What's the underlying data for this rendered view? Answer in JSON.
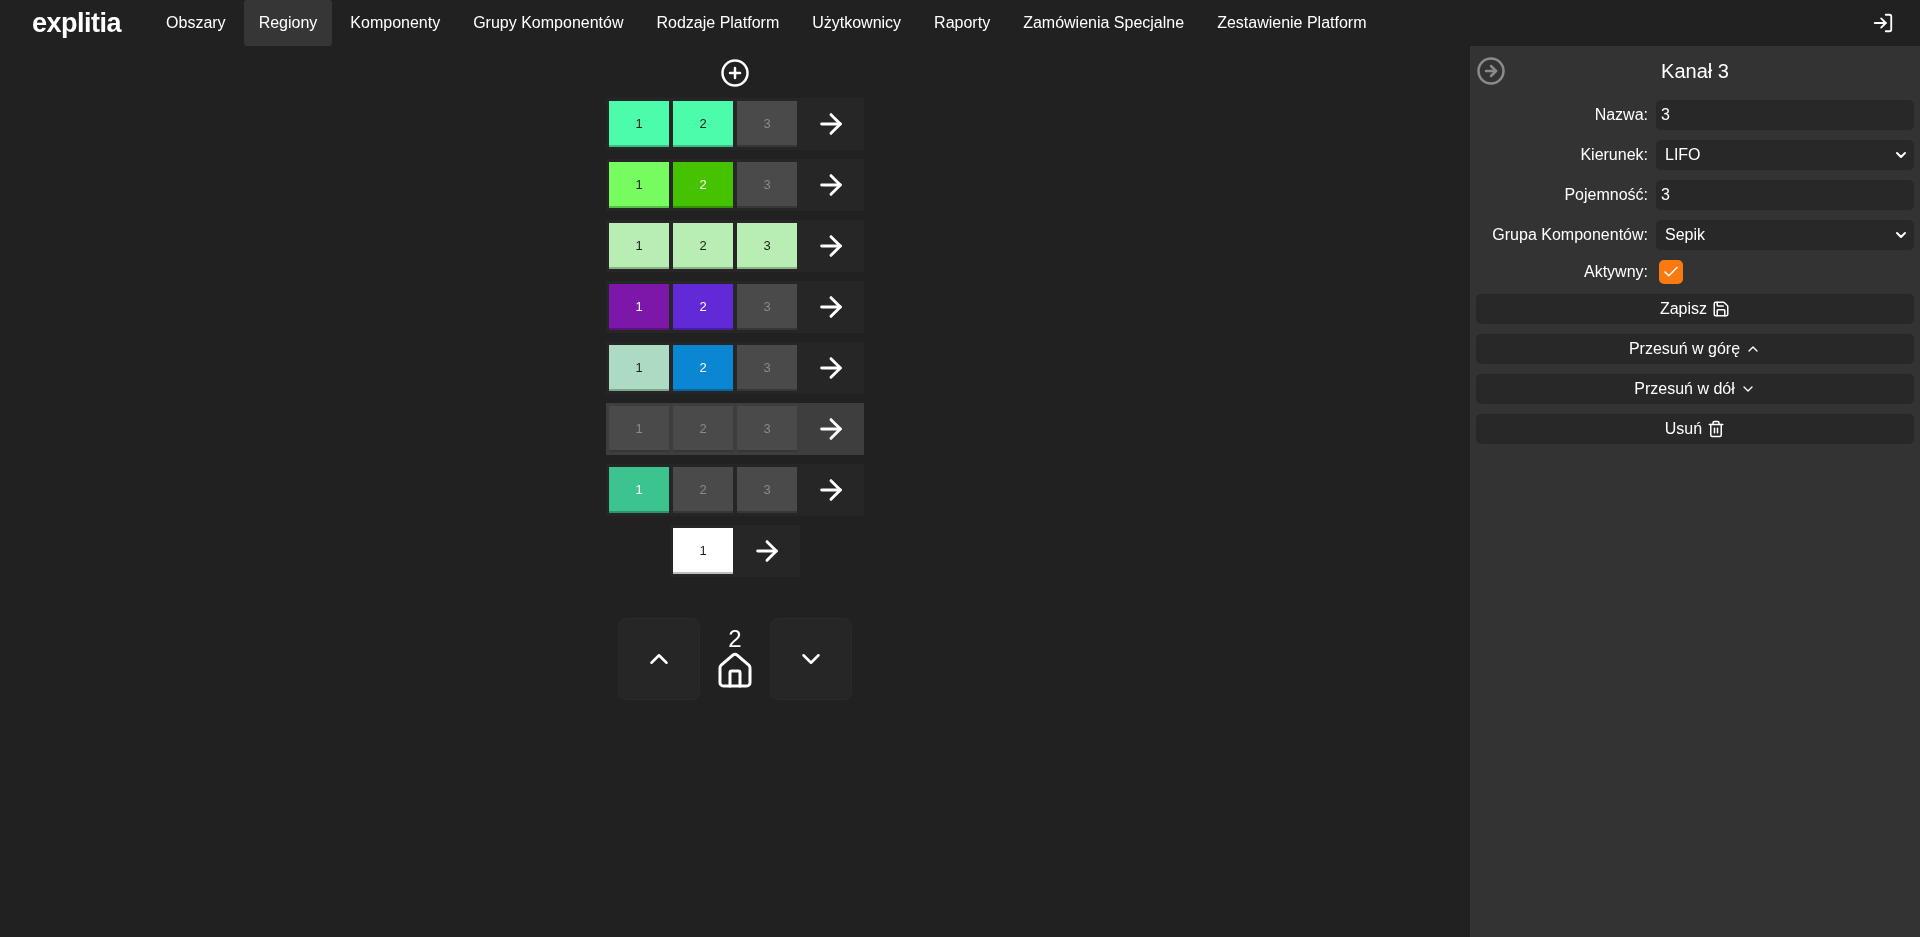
{
  "nav": {
    "logo": "explitia",
    "items": [
      {
        "label": "Obszary",
        "selected": false
      },
      {
        "label": "Regiony",
        "selected": true
      },
      {
        "label": "Komponenty",
        "selected": false
      },
      {
        "label": "Grupy Komponentów",
        "selected": false
      },
      {
        "label": "Rodzaje Platform",
        "selected": false
      },
      {
        "label": "Użytkownicy",
        "selected": false
      },
      {
        "label": "Raporty",
        "selected": false
      },
      {
        "label": "Zamówienia Specjalne",
        "selected": false
      },
      {
        "label": "Zestawienie Platform",
        "selected": false
      }
    ]
  },
  "channels": [
    {
      "selected": false,
      "cells": [
        {
          "label": "1",
          "filled": true,
          "color": "#4cfcab"
        },
        {
          "label": "2",
          "filled": true,
          "color": "#4cfcab"
        },
        {
          "label": "3",
          "filled": false
        }
      ]
    },
    {
      "selected": false,
      "cells": [
        {
          "label": "1",
          "filled": true,
          "color": "#76fc5e"
        },
        {
          "label": "2",
          "filled": true,
          "color": "#46c300"
        },
        {
          "label": "3",
          "filled": false
        }
      ]
    },
    {
      "selected": false,
      "cells": [
        {
          "label": "1",
          "filled": true,
          "color": "#b8edb4"
        },
        {
          "label": "2",
          "filled": true,
          "color": "#b8edb4"
        },
        {
          "label": "3",
          "filled": true,
          "color": "#b8edb4"
        }
      ]
    },
    {
      "selected": false,
      "cells": [
        {
          "label": "1",
          "filled": true,
          "color": "#7d17aa"
        },
        {
          "label": "2",
          "filled": true,
          "color": "#6229d6"
        },
        {
          "label": "3",
          "filled": false
        }
      ]
    },
    {
      "selected": false,
      "cells": [
        {
          "label": "1",
          "filled": true,
          "color": "#acdac2"
        },
        {
          "label": "2",
          "filled": true,
          "color": "#0b86d2"
        },
        {
          "label": "3",
          "filled": false
        }
      ]
    },
    {
      "selected": true,
      "cells": [
        {
          "label": "1",
          "filled": false
        },
        {
          "label": "2",
          "filled": false
        },
        {
          "label": "3",
          "filled": false
        }
      ]
    },
    {
      "selected": false,
      "cells": [
        {
          "label": "1",
          "filled": true,
          "color": "#3bc48e"
        },
        {
          "label": "2",
          "filled": false
        },
        {
          "label": "3",
          "filled": false
        }
      ]
    },
    {
      "selected": false,
      "cells": [
        {
          "label": "1",
          "filled": true,
          "color": "#ffffff"
        }
      ]
    }
  ],
  "level": {
    "number": "2"
  },
  "panel": {
    "title": "Kanał 3",
    "fields": [
      {
        "kind": "text",
        "label": "Nazwa:",
        "value": "3"
      },
      {
        "kind": "select",
        "label": "Kierunek:",
        "value": "LIFO"
      },
      {
        "kind": "text",
        "label": "Pojemność:",
        "value": "3"
      },
      {
        "kind": "select",
        "label": "Grupa Komponentów:",
        "value": "Sepik"
      },
      {
        "kind": "checkbox",
        "label": "Aktywny:",
        "checked": true
      }
    ],
    "buttons": [
      {
        "kind": "save",
        "label": "Zapisz"
      },
      {
        "kind": "up",
        "label": "Przesuń w górę"
      },
      {
        "kind": "down",
        "label": "Przesuń w dół"
      },
      {
        "kind": "delete",
        "label": "Usuń"
      }
    ]
  }
}
